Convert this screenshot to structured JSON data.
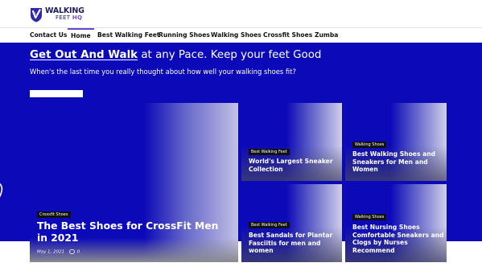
{
  "brand": {
    "line1": "WALKING",
    "line2": "FEET",
    "line3": "HQ"
  },
  "nav": [
    "Contact Us",
    "Home",
    "Best Walking Feet",
    "Running Shoes",
    "Walking Shoes",
    "Crossfit Shoes",
    "Zumba"
  ],
  "nav_active": "Home",
  "hero": {
    "title_strong": "Get Out And Walk",
    "title_rest": " at any Pace. Keep your feet Good",
    "subtitle": "When's the last time you really thought about how well your walking shoes fit?"
  },
  "featured": {
    "category": "Crossfit Shoes",
    "title": "The Best Shoes for CrossFit Men in 2021",
    "date": "May 1, 2021",
    "comments": "0"
  },
  "cards": [
    {
      "category": "Best Walking Feet",
      "title": "World's Largest Sneaker Collection"
    },
    {
      "category": "Walking Shoes",
      "title": "Best Walking Shoes and Sneakers for Men and Women"
    },
    {
      "category": "Best Walking Feet",
      "title": "Best Sandals for Plantar Fasciitis for men and women"
    },
    {
      "category": "Walking Shoes",
      "title": "Best Nursing Shoes Comfortable Sneakers and Clogs by Nurses Recommend"
    }
  ],
  "colors": {
    "hero": "#0c0ab8",
    "accent": "#6b45c8",
    "brand_text": "#1c1b5e"
  },
  "icons": [
    "logo-shield-icon",
    "comment-icon",
    "partial-side-icon"
  ]
}
